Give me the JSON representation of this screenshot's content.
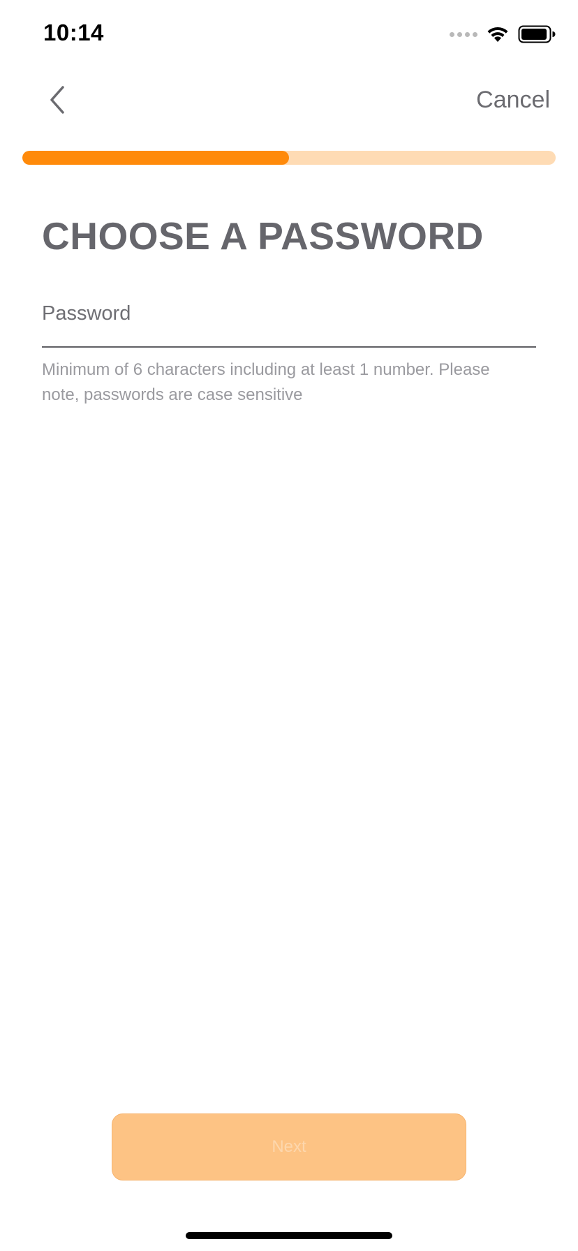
{
  "status_bar": {
    "time": "10:14",
    "icons": [
      "signal-dots-icon",
      "wifi-icon",
      "battery-icon"
    ]
  },
  "nav": {
    "back_icon": "chevron-left-icon",
    "cancel_label": "Cancel"
  },
  "progress": {
    "fraction": 0.5,
    "fill_color": "#ff8a0a",
    "track_color": "#fedbb4"
  },
  "page": {
    "title": "CHOOSE A PASSWORD"
  },
  "form": {
    "password_placeholder": "Password",
    "password_value": "",
    "hint": "Minimum of 6 characters including at least 1 number. Please note, passwords are case sensitive"
  },
  "footer": {
    "next_label": "Next",
    "next_color": "#fdc384"
  }
}
